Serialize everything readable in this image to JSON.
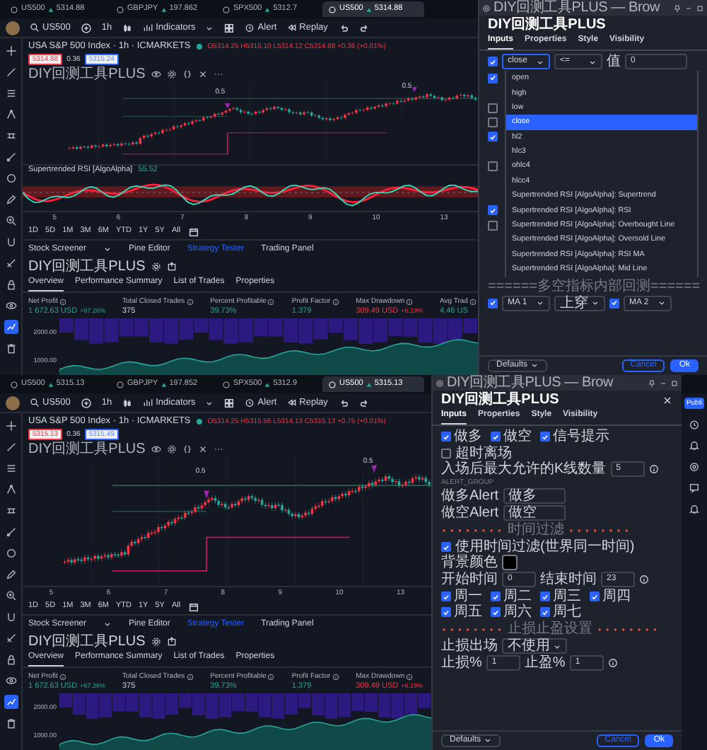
{
  "panels": [
    {
      "browser_tabs": [
        {
          "symbol": "US500",
          "price": "5314.88",
          "selected": false
        },
        {
          "symbol": "GBPJPY",
          "price": "197.862",
          "selected": false
        },
        {
          "symbol": "SPX500",
          "price": "5312.7",
          "selected": false
        },
        {
          "symbol": "US500",
          "price": "5314.88",
          "selected": true
        }
      ],
      "toolbar": {
        "symbol": "US500",
        "interval": "1h",
        "buttons": [
          "Indicators",
          "Alert",
          "Replay"
        ]
      },
      "left_toolbar": [
        {
          "kind": "crosshair",
          "selected": false
        },
        {
          "kind": "line",
          "selected": false
        },
        {
          "kind": "lines",
          "selected": false
        },
        {
          "kind": "node",
          "selected": false
        },
        {
          "kind": "ruler",
          "selected": false
        },
        {
          "kind": "brush",
          "selected": false
        },
        {
          "kind": "circle",
          "selected": false
        },
        {
          "kind": "pencil",
          "selected": false
        },
        {
          "kind": "zoom",
          "selected": false
        },
        {
          "kind": "magnet",
          "selected": false
        },
        {
          "kind": "measure",
          "selected": false
        },
        {
          "kind": "lock",
          "selected": false
        },
        {
          "kind": "eye",
          "selected": false
        },
        {
          "kind": "strategy",
          "selected": true
        },
        {
          "kind": "trash",
          "selected": false
        }
      ],
      "chart": {
        "title": "USA S&P 500 Index · 1h · ICMARKETS",
        "ohlc": "O5314.25 H5315.10 L5314.12 C5314.88 +0.36 (+0.01%)",
        "sell": "5314.88",
        "spread": "0.36",
        "buy": "5315.24",
        "indicator": "DIY回测工具PLUS",
        "annotations": [
          "0.5",
          "0.5"
        ],
        "rsi": {
          "name": "Supertrended RSI [AlgoAlpha]",
          "value": "55.52"
        },
        "x_axis": [
          "5",
          "6",
          "7",
          "8",
          "9",
          "10",
          "13"
        ]
      },
      "ranges": [
        "1D",
        "5D",
        "1M",
        "3M",
        "6M",
        "YTD",
        "1Y",
        "5Y",
        "All"
      ],
      "bottom_tabs": [
        {
          "label": "Stock Screener",
          "selected": false
        },
        {
          "label": "Pine Editor",
          "selected": false
        },
        {
          "label": "Strategy Tester",
          "selected": true
        },
        {
          "label": "Trading Panel",
          "selected": false
        }
      ],
      "strategy": {
        "name": "DIY回测工具PLUS",
        "tabs": [
          {
            "label": "Overview",
            "selected": true
          },
          {
            "label": "Performance Summary",
            "selected": false
          },
          {
            "label": "List of Trades",
            "selected": false
          },
          {
            "label": "Properties",
            "selected": false
          }
        ],
        "metrics": [
          {
            "label": "Net Profit",
            "value": "1 672.63 USD",
            "change": "+67.26%",
            "color": "#26a69a"
          },
          {
            "label": "Total Closed Trades",
            "value": "375",
            "color": "#d1d4dc"
          },
          {
            "label": "Percent Profitable",
            "value": "39.73%",
            "color": "#26a69a"
          },
          {
            "label": "Profit Factor",
            "value": "1.379",
            "color": "#26a69a"
          },
          {
            "label": "Max Drawdown",
            "value": "309.49 USD",
            "change": "+6.19%",
            "color": "#f23645"
          },
          {
            "label": "Avg Trad",
            "value": "4.46 US",
            "color": "#26a69a"
          }
        ],
        "equity_axis": [
          "2000.00",
          "1000.00"
        ]
      },
      "dialog": {
        "window_title": "DIY回测工具PLUS — Brow",
        "title": "DIY回测工具PLUS",
        "tabs": [
          {
            "label": "Inputs",
            "selected": true
          },
          {
            "label": "Properties",
            "selected": false
          },
          {
            "label": "Style",
            "selected": false
          },
          {
            "label": "Visibility",
            "selected": false
          }
        ],
        "rows": [
          {
            "kind": "condition",
            "checked": true,
            "source": "close",
            "operator": "<=",
            "value_label": "值",
            "value": "0"
          },
          {
            "kind": "dropdown",
            "items": [
              {
                "label": "open",
                "selected": false,
                "checkbox": true
              },
              {
                "label": "high",
                "selected": false
              },
              {
                "label": "low",
                "selected": false,
                "checkbox": false
              },
              {
                "label": "close",
                "selected": true,
                "checkbox": false
              },
              {
                "label": "hl2",
                "selected": false,
                "checkbox": true
              },
              {
                "label": "hlc3",
                "selected": false
              },
              {
                "label": "ohlc4",
                "selected": false,
                "checkbox": false
              },
              {
                "label": "hlcc4",
                "selected": false
              },
              {
                "label": "Supertrended RSI [AlgoAlpha]: Supertrend",
                "selected": false
              },
              {
                "label": "Supertrended RSI [AlgoAlpha]: RSI",
                "selected": false,
                "checkbox": true
              },
              {
                "label": "Supertrended RSI [AlgoAlpha]: Overbought Line",
                "selected": false,
                "checkbox": false
              },
              {
                "label": "Supertrended RSI [AlgoAlpha]: Oversold Line",
                "selected": false
              },
              {
                "label": "Supertrended RSI [AlgoAlpha]: RSI MA",
                "selected": false
              },
              {
                "label": "Supertrended RSI [AlgoAlpha]: Mid Line",
                "selected": false
              }
            ]
          },
          {
            "kind": "heading",
            "text": "======多空指标内部回测======"
          },
          {
            "kind": "ma-pair",
            "checked_a": true,
            "select_a": "MA 1",
            "cross": "上穿",
            "checked_b": true,
            "select_b": "MA 2"
          }
        ],
        "footer": {
          "defaults": "Defaults",
          "cancel": "Cancel",
          "ok": "Ok"
        }
      }
    },
    {
      "browser_tabs": [
        {
          "symbol": "US500",
          "price": "5315.13",
          "selected": false
        },
        {
          "symbol": "GBPJPY",
          "price": "197.852",
          "selected": false
        },
        {
          "symbol": "SPX500",
          "price": "5312.9",
          "selected": false
        },
        {
          "symbol": "US500",
          "price": "5315.13",
          "selected": true
        }
      ],
      "toolbar": {
        "symbol": "US500",
        "interval": "1h",
        "buttons": [
          "Indicators",
          "Alert",
          "Replay"
        ]
      },
      "left_toolbar": [
        {
          "kind": "crosshair",
          "selected": false
        },
        {
          "kind": "line",
          "selected": false
        },
        {
          "kind": "lines",
          "selected": false
        },
        {
          "kind": "node",
          "selected": false
        },
        {
          "kind": "ruler",
          "selected": false
        },
        {
          "kind": "brush",
          "selected": false
        },
        {
          "kind": "circle",
          "selected": false
        },
        {
          "kind": "pencil",
          "selected": false
        },
        {
          "kind": "zoom",
          "selected": false
        },
        {
          "kind": "magnet",
          "selected": false
        },
        {
          "kind": "measure",
          "selected": false
        },
        {
          "kind": "lock",
          "selected": false
        },
        {
          "kind": "eye",
          "selected": false
        },
        {
          "kind": "strategy",
          "selected": true
        },
        {
          "kind": "trash",
          "selected": false
        }
      ],
      "chart": {
        "title": "USA S&P 500 Index · 1h · ICMARKETS",
        "ohlc": "O5314.25 H5315.56 L5314.13 C5315.13 +0.75 (+0.01%)",
        "sell": "5315.13",
        "spread": "0.36",
        "buy": "5315.49",
        "indicator": "DIY回测工具PLUS",
        "annotations": [
          "0.5",
          "0.5"
        ],
        "x_axis": [
          "5",
          "6",
          "7",
          "8",
          "9",
          "10",
          "13"
        ]
      },
      "ranges": [
        "1D",
        "5D",
        "1M",
        "3M",
        "6M",
        "YTD",
        "1Y",
        "5Y",
        "All"
      ],
      "bottom_tabs": [
        {
          "label": "Stock Screener",
          "selected": false
        },
        {
          "label": "Pine Editor",
          "selected": false
        },
        {
          "label": "Strategy Tester",
          "selected": true
        },
        {
          "label": "Trading Panel",
          "selected": false
        }
      ],
      "strategy": {
        "name": "DIY回测工具PLUS",
        "tabs": [
          {
            "label": "Overview",
            "selected": true
          },
          {
            "label": "Performance Summary",
            "selected": false
          },
          {
            "label": "List of Trades",
            "selected": false
          },
          {
            "label": "Properties",
            "selected": false
          }
        ],
        "metrics": [
          {
            "label": "Net Profit",
            "value": "1 672.63 USD",
            "change": "+67.26%",
            "color": "#26a69a"
          },
          {
            "label": "Total Closed Trades",
            "value": "375",
            "color": "#d1d4dc"
          },
          {
            "label": "Percent Profitable",
            "value": "39.73%",
            "color": "#26a69a"
          },
          {
            "label": "Profit Factor",
            "value": "1.379",
            "color": "#26a69a"
          },
          {
            "label": "Max Drawdown",
            "value": "309.49 USD",
            "change": "+6.19%",
            "color": "#f23645"
          }
        ],
        "equity_axis": [
          "2000.00",
          "1000.00"
        ]
      },
      "dialog": {
        "window_title": "DIY回测工具PLUS — Brow",
        "title": "DIY回测工具PLUS",
        "close_button": true,
        "tabs": [
          {
            "label": "Inputs",
            "selected": true
          },
          {
            "label": "Properties",
            "selected": false
          },
          {
            "label": "Style",
            "selected": false
          },
          {
            "label": "Visibility",
            "selected": false
          }
        ],
        "rows": [
          {
            "kind": "checks",
            "items": [
              {
                "label": "做多",
                "checked": true
              },
              {
                "label": "做空",
                "checked": true
              },
              {
                "label": "信号提示",
                "checked": true
              }
            ]
          },
          {
            "kind": "check-field",
            "checked": false,
            "label": "超时离场",
            "field_label": "入场后最大允许的K线数量",
            "value": "5"
          },
          {
            "kind": "group",
            "text": "ALERT_GROUP"
          },
          {
            "kind": "field",
            "label": "做多Alert",
            "value": "做多"
          },
          {
            "kind": "field",
            "label": "做空Alert",
            "value": "做空"
          },
          {
            "kind": "divider",
            "text": "时间过滤"
          },
          {
            "kind": "check-color",
            "checked": true,
            "label": "使用时间过滤(世界同一时间)",
            "color_label": "背景颜色",
            "color": "#000000"
          },
          {
            "kind": "fields",
            "items": [
              {
                "label": "开始时间",
                "value": "0"
              },
              {
                "label": "结束时间",
                "value": "23"
              }
            ]
          },
          {
            "kind": "checks",
            "items": [
              {
                "label": "周一",
                "checked": true
              },
              {
                "label": "周二",
                "checked": true
              },
              {
                "label": "周三",
                "checked": true
              },
              {
                "label": "周四",
                "checked": true
              },
              {
                "label": "周五",
                "checked": true
              },
              {
                "label": "周六",
                "checked": true
              },
              {
                "label": "周七",
                "checked": true
              }
            ]
          },
          {
            "kind": "divider",
            "text": "止损止盈设置"
          },
          {
            "kind": "select",
            "label": "止损出场",
            "value": "不使用"
          },
          {
            "kind": "fields",
            "items": [
              {
                "label": "止损%",
                "value": "1"
              },
              {
                "label": "止盈%",
                "value": "1"
              }
            ]
          }
        ],
        "footer": {
          "defaults": "Defaults",
          "cancel": "Cancel",
          "ok": "Ok"
        }
      },
      "right_sidebar": {
        "publish": "Publi"
      }
    }
  ]
}
